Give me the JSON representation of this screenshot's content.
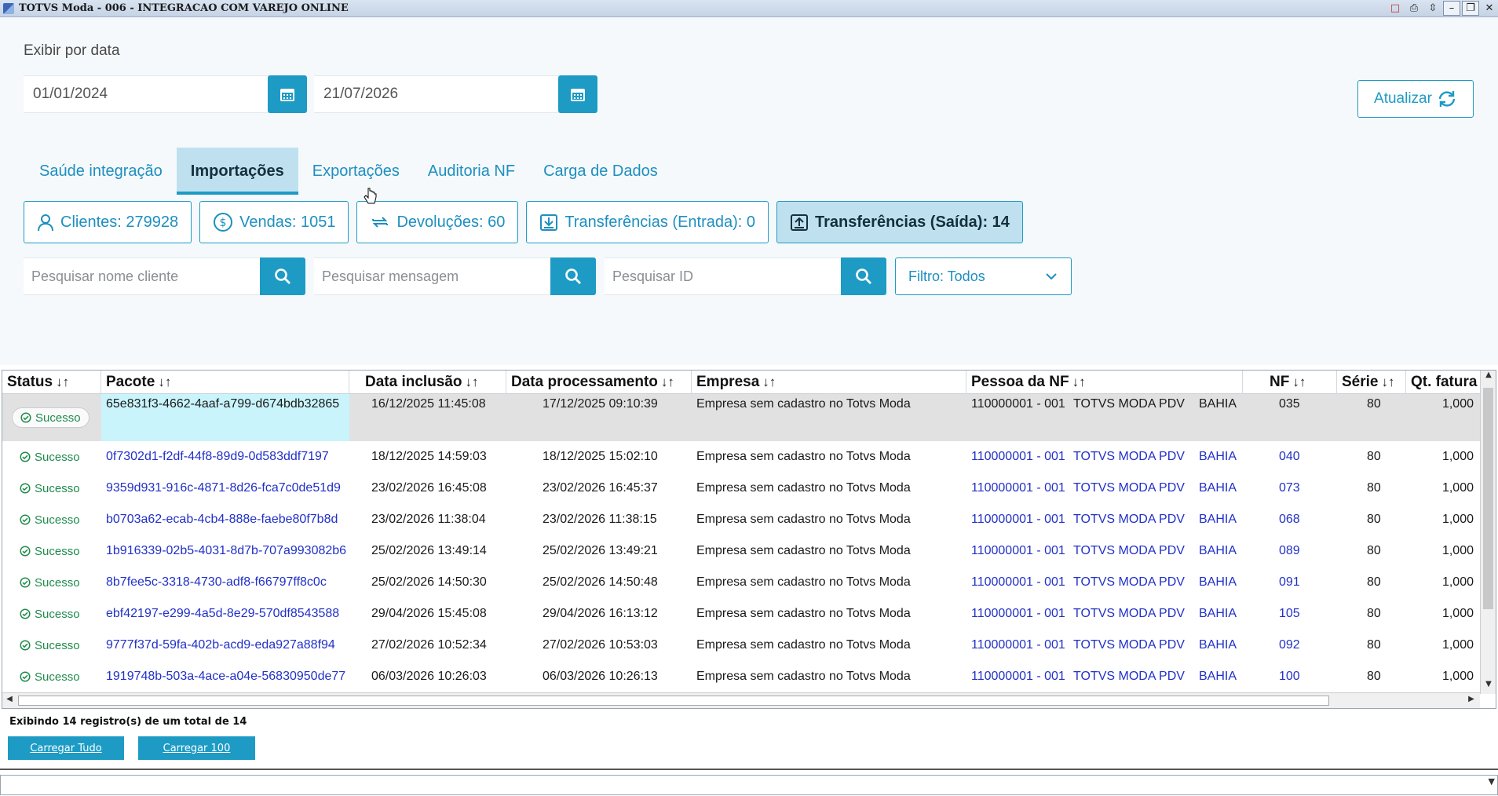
{
  "window": {
    "title": "TOTVS Moda - 006 - INTEGRACAO COM VAREJO ONLINE"
  },
  "filters": {
    "date_label": "Exibir por data",
    "start_date": "01/01/2024",
    "end_date": "21/07/2026",
    "refresh_label": "Atualizar"
  },
  "tabs": [
    {
      "label": "Saúde integração",
      "active": false
    },
    {
      "label": "Importações",
      "active": true
    },
    {
      "label": "Exportações",
      "active": false
    },
    {
      "label": "Auditoria NF",
      "active": false
    },
    {
      "label": "Carga de Dados",
      "active": false
    }
  ],
  "counters": [
    {
      "label": "Clientes: 279928",
      "icon": "user-icon"
    },
    {
      "label": "Vendas: 1051",
      "icon": "dollar-icon"
    },
    {
      "label": "Devoluções: 60",
      "icon": "return-icon"
    },
    {
      "label": "Transferências (Entrada): 0",
      "icon": "download-icon"
    },
    {
      "label": "Transferências (Saída): 14",
      "icon": "upload-icon",
      "active": true
    }
  ],
  "search": {
    "client_placeholder": "Pesquisar nome cliente",
    "message_placeholder": "Pesquisar mensagem",
    "id_placeholder": "Pesquisar ID",
    "filter_label": "Filtro: Todos"
  },
  "grid": {
    "columns": [
      "Status",
      "Pacote",
      "Data inclusão",
      "Data processamento",
      "Empresa",
      "Pessoa da NF",
      "NF",
      "Série",
      "Qt. fatura"
    ],
    "sort_glyph": "↓↑",
    "rows": [
      {
        "status": "Sucesso",
        "pacote": "65e831f3-4662-4aaf-a799-d674bdb32865",
        "inclusao": "16/12/2025 11:45:08",
        "processamento": "17/12/2025 09:10:39",
        "empresa": "Empresa sem cadastro no Totvs Moda",
        "pessoa_cod": "110000001 - 001",
        "pessoa_nome": "TOTVS MODA PDV",
        "pessoa_uf": "BAHIA",
        "nf": "035",
        "serie": "80",
        "qt": "1,000",
        "selected": true
      },
      {
        "status": "Sucesso",
        "pacote": "0f7302d1-f2df-44f8-89d9-0d583ddf7197",
        "inclusao": "18/12/2025 14:59:03",
        "processamento": "18/12/2025 15:02:10",
        "empresa": "Empresa sem cadastro no Totvs Moda",
        "pessoa_cod": "110000001 - 001",
        "pessoa_nome": "TOTVS MODA PDV",
        "pessoa_uf": "BAHIA",
        "nf": "040",
        "serie": "80",
        "qt": "1,000"
      },
      {
        "status": "Sucesso",
        "pacote": "9359d931-916c-4871-8d26-fca7c0de51d9",
        "inclusao": "23/02/2026 16:45:08",
        "processamento": "23/02/2026 16:45:37",
        "empresa": "Empresa sem cadastro no Totvs Moda",
        "pessoa_cod": "110000001 - 001",
        "pessoa_nome": "TOTVS MODA PDV",
        "pessoa_uf": "BAHIA",
        "nf": "073",
        "serie": "80",
        "qt": "1,000"
      },
      {
        "status": "Sucesso",
        "pacote": "b0703a62-ecab-4cb4-888e-faebe80f7b8d",
        "inclusao": "23/02/2026 11:38:04",
        "processamento": "23/02/2026 11:38:15",
        "empresa": "Empresa sem cadastro no Totvs Moda",
        "pessoa_cod": "110000001 - 001",
        "pessoa_nome": "TOTVS MODA PDV",
        "pessoa_uf": "BAHIA",
        "nf": "068",
        "serie": "80",
        "qt": "1,000"
      },
      {
        "status": "Sucesso",
        "pacote": "1b916339-02b5-4031-8d7b-707a993082b6",
        "inclusao": "25/02/2026 13:49:14",
        "processamento": "25/02/2026 13:49:21",
        "empresa": "Empresa sem cadastro no Totvs Moda",
        "pessoa_cod": "110000001 - 001",
        "pessoa_nome": "TOTVS MODA PDV",
        "pessoa_uf": "BAHIA",
        "nf": "089",
        "serie": "80",
        "qt": "1,000"
      },
      {
        "status": "Sucesso",
        "pacote": "8b7fee5c-3318-4730-adf8-f66797ff8c0c",
        "inclusao": "25/02/2026 14:50:30",
        "processamento": "25/02/2026 14:50:48",
        "empresa": "Empresa sem cadastro no Totvs Moda",
        "pessoa_cod": "110000001 - 001",
        "pessoa_nome": "TOTVS MODA PDV",
        "pessoa_uf": "BAHIA",
        "nf": "091",
        "serie": "80",
        "qt": "1,000"
      },
      {
        "status": "Sucesso",
        "pacote": "ebf42197-e299-4a5d-8e29-570df8543588",
        "inclusao": "29/04/2026 15:45:08",
        "processamento": "29/04/2026 16:13:12",
        "empresa": "Empresa sem cadastro no Totvs Moda",
        "pessoa_cod": "110000001 - 001",
        "pessoa_nome": "TOTVS MODA PDV",
        "pessoa_uf": "BAHIA",
        "nf": "105",
        "serie": "80",
        "qt": "1,000"
      },
      {
        "status": "Sucesso",
        "pacote": "9777f37d-59fa-402b-acd9-eda927a88f94",
        "inclusao": "27/02/2026 10:52:34",
        "processamento": "27/02/2026 10:53:03",
        "empresa": "Empresa sem cadastro no Totvs Moda",
        "pessoa_cod": "110000001 - 001",
        "pessoa_nome": "TOTVS MODA PDV",
        "pessoa_uf": "BAHIA",
        "nf": "092",
        "serie": "80",
        "qt": "1,000"
      },
      {
        "status": "Sucesso",
        "pacote": "1919748b-503a-4ace-a04e-56830950de77",
        "inclusao": "06/03/2026 10:26:03",
        "processamento": "06/03/2026 10:26:13",
        "empresa": "Empresa sem cadastro no Totvs Moda",
        "pessoa_cod": "110000001 - 001",
        "pessoa_nome": "TOTVS MODA PDV",
        "pessoa_uf": "BAHIA",
        "nf": "100",
        "serie": "80",
        "qt": "1,000"
      }
    ]
  },
  "footer": {
    "summary": "Exibindo 14 registro(s) de um total de 14",
    "load_all": "Carregar Tudo",
    "load_100": "Carregar 100"
  },
  "colors": {
    "accent": "#1d9bc4",
    "active_tab_bg": "#bfe1ef",
    "link": "#2130c9",
    "success": "#1f8b4c"
  }
}
